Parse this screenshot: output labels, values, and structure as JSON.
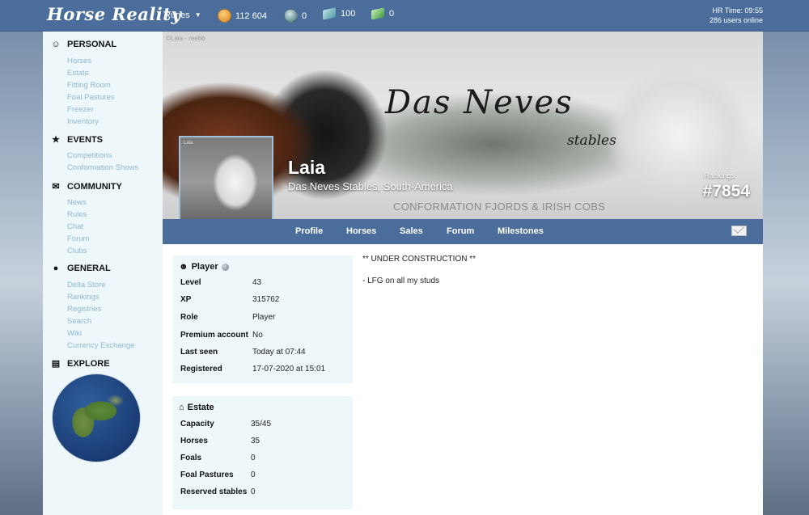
{
  "topbar": {
    "logo": "Horse Reality",
    "runes_label": "Runes",
    "currencies": [
      {
        "icon": "gold-coin-icon",
        "value": "112 604"
      },
      {
        "icon": "dark-coin-icon",
        "value": "0"
      },
      {
        "icon": "teal-banknote-icon",
        "value": "100"
      },
      {
        "icon": "green-banknote-icon",
        "value": "0"
      }
    ],
    "hr_time": "HR Time: 09:55",
    "users_online": "286 users online"
  },
  "sidebar": {
    "personal": {
      "label": "PERSONAL",
      "icon": "user-circle-icon",
      "items": [
        "Horses",
        "Estate",
        "Fitting Room",
        "Foal Pastures",
        "Freezer",
        "Inventory"
      ]
    },
    "events": {
      "label": "EVENTS",
      "icon": "star-icon",
      "items": [
        "Competitions",
        "Conformation Shows"
      ]
    },
    "community": {
      "label": "COMMUNITY",
      "icon": "chat-bubbles-icon",
      "items": [
        "News",
        "Rules",
        "Chat",
        "Forum",
        "Clubs"
      ]
    },
    "general": {
      "label": "GENERAL",
      "icon": "globe-icon",
      "items": [
        "Delta Store",
        "Rankings",
        "Registries",
        "Search",
        "Wiki",
        "Currency Exchange"
      ]
    },
    "explore": {
      "label": "EXPLORE",
      "icon": "map-icon"
    }
  },
  "banner": {
    "watermark": "©Laia - reebb",
    "stable_script": "Das Neves",
    "stable_sub": "stables",
    "avatar_tag": "Laia",
    "player_name": "Laia",
    "player_stable": "Das Neves Stables, South-America",
    "conformation_text": "CONFORMATION FJORDS & IRISH COBS",
    "rankings_label": "Rankings",
    "ranking_value": "#7854"
  },
  "profile_nav": {
    "tabs": [
      "Profile",
      "Horses",
      "Sales",
      "Forum",
      "Milestones"
    ]
  },
  "player_card": {
    "title": "Player",
    "rows": [
      {
        "key": "Level",
        "value": "43"
      },
      {
        "key": "XP",
        "value": "315762"
      },
      {
        "key": "Role",
        "value": "Player"
      },
      {
        "key": "Premium account",
        "value": "No"
      },
      {
        "key": "Last seen",
        "value": "Today at 07:44"
      },
      {
        "key": "Registered",
        "value": "17-07-2020 at 15:01"
      }
    ]
  },
  "estate_card": {
    "title": "Estate",
    "rows": [
      {
        "key": "Capacity",
        "value": "35/45"
      },
      {
        "key": "Horses",
        "value": "35"
      },
      {
        "key": "Foals",
        "value": "0"
      },
      {
        "key": "Foal Pastures",
        "value": "0"
      },
      {
        "key": "Reserved stables",
        "value": "0"
      }
    ]
  },
  "bio": {
    "line1": "** UNDER CONSTRUCTION **",
    "line2": "- LFG on all my studs"
  }
}
